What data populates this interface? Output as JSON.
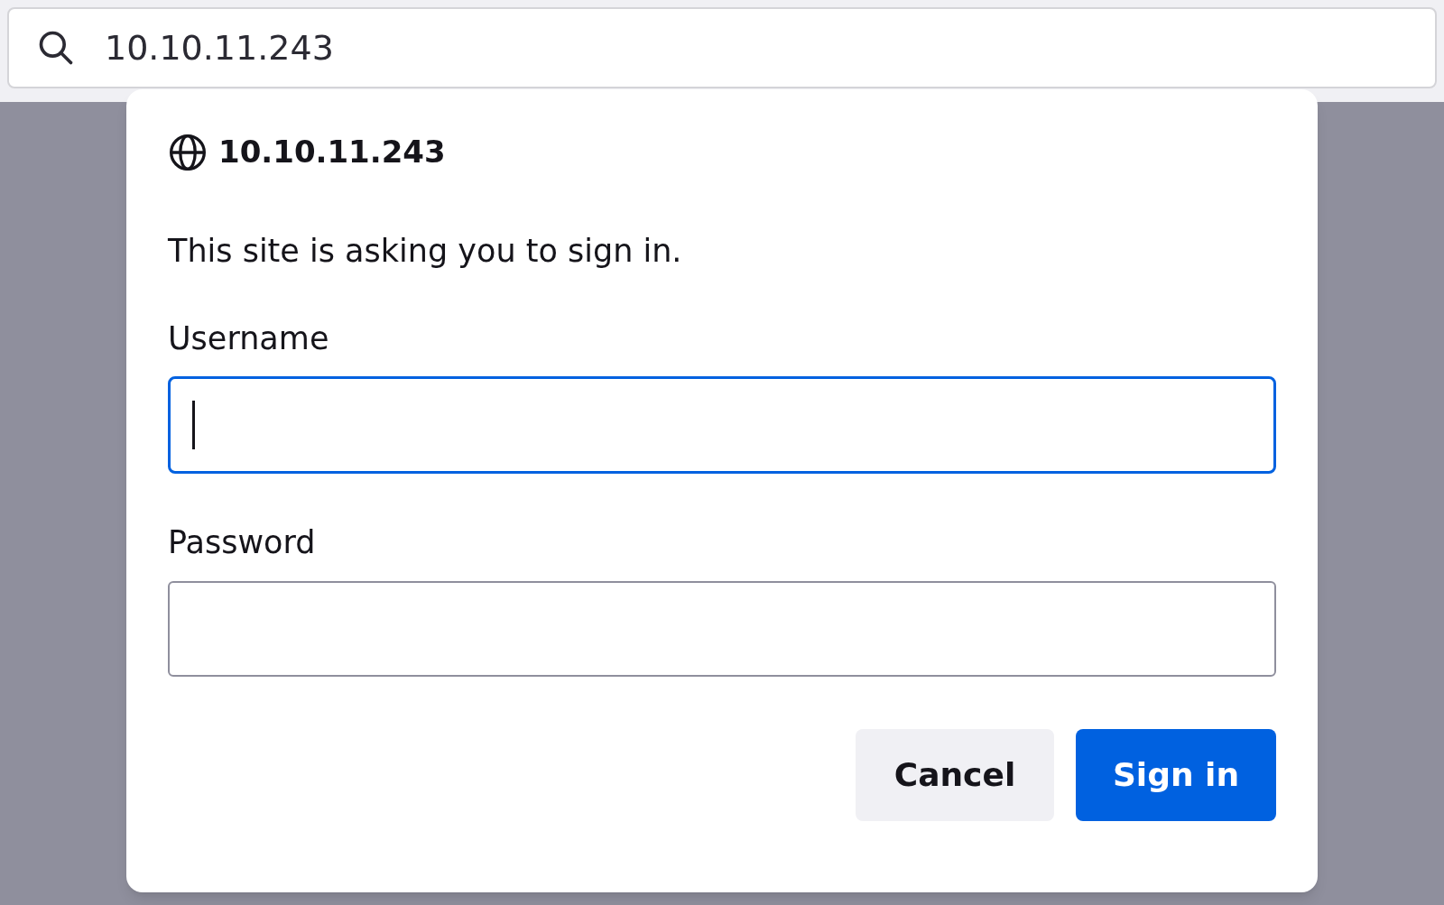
{
  "address_bar": {
    "value": "10.10.11.243"
  },
  "dialog": {
    "title": "10.10.11.243",
    "message": "This site is asking you to sign in.",
    "fields": [
      {
        "label": "Username",
        "focused": true
      },
      {
        "label": "Password",
        "focused": false
      }
    ],
    "buttons": [
      {
        "label": "Cancel",
        "kind": "secondary"
      },
      {
        "label": "Sign in",
        "kind": "primary"
      }
    ]
  }
}
